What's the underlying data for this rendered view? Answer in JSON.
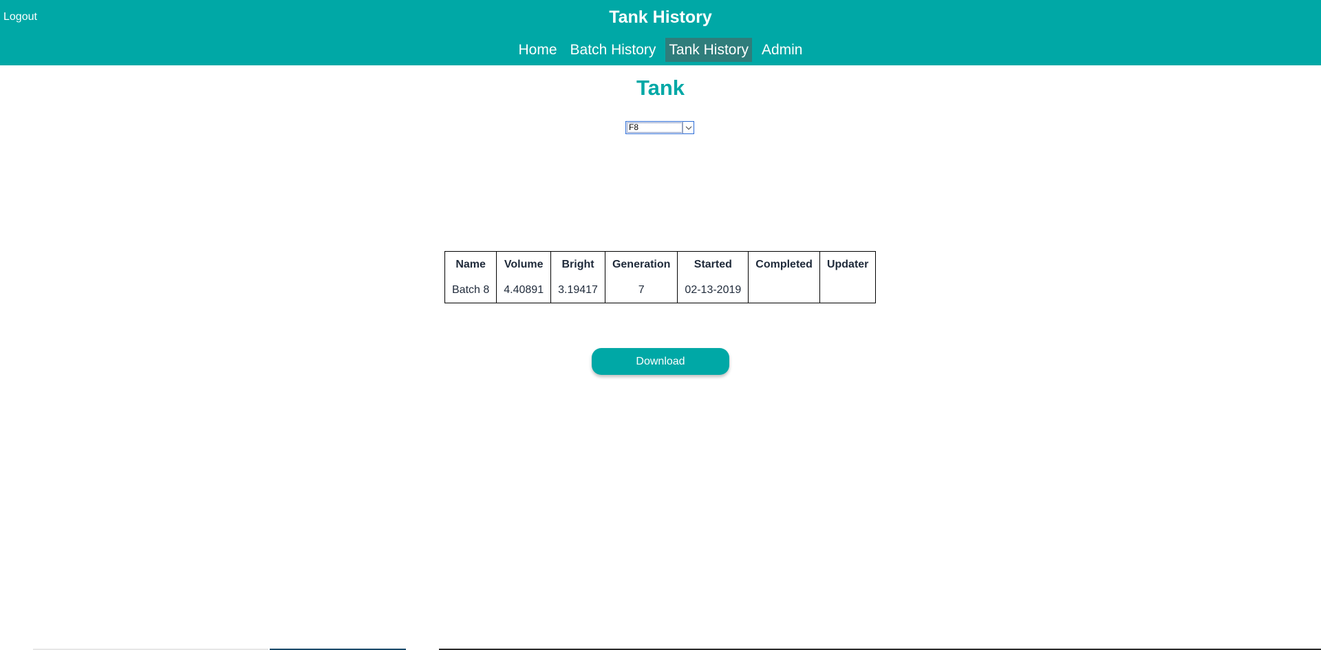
{
  "header": {
    "logout_label": "Logout",
    "app_title": "Tank History",
    "nav": [
      {
        "label": "Home",
        "active": false
      },
      {
        "label": "Batch History",
        "active": false
      },
      {
        "label": "Tank History",
        "active": true
      },
      {
        "label": "Admin",
        "active": false
      }
    ]
  },
  "main": {
    "title": "Tank",
    "tank_select": {
      "selected": "F8",
      "arrow_icon": "chevron-down-icon"
    },
    "table": {
      "columns": [
        "Name",
        "Volume",
        "Bright",
        "Generation",
        "Started",
        "Completed",
        "Updater"
      ],
      "rows": [
        [
          "Batch 8",
          "4.40891",
          "3.19417",
          "7",
          "02-13-2019",
          "",
          ""
        ]
      ]
    },
    "download_label": "Download"
  },
  "colors": {
    "accent": "#00a8a6",
    "nav_active": "#2f7d7b",
    "text_dark": "#1f2a3a"
  }
}
